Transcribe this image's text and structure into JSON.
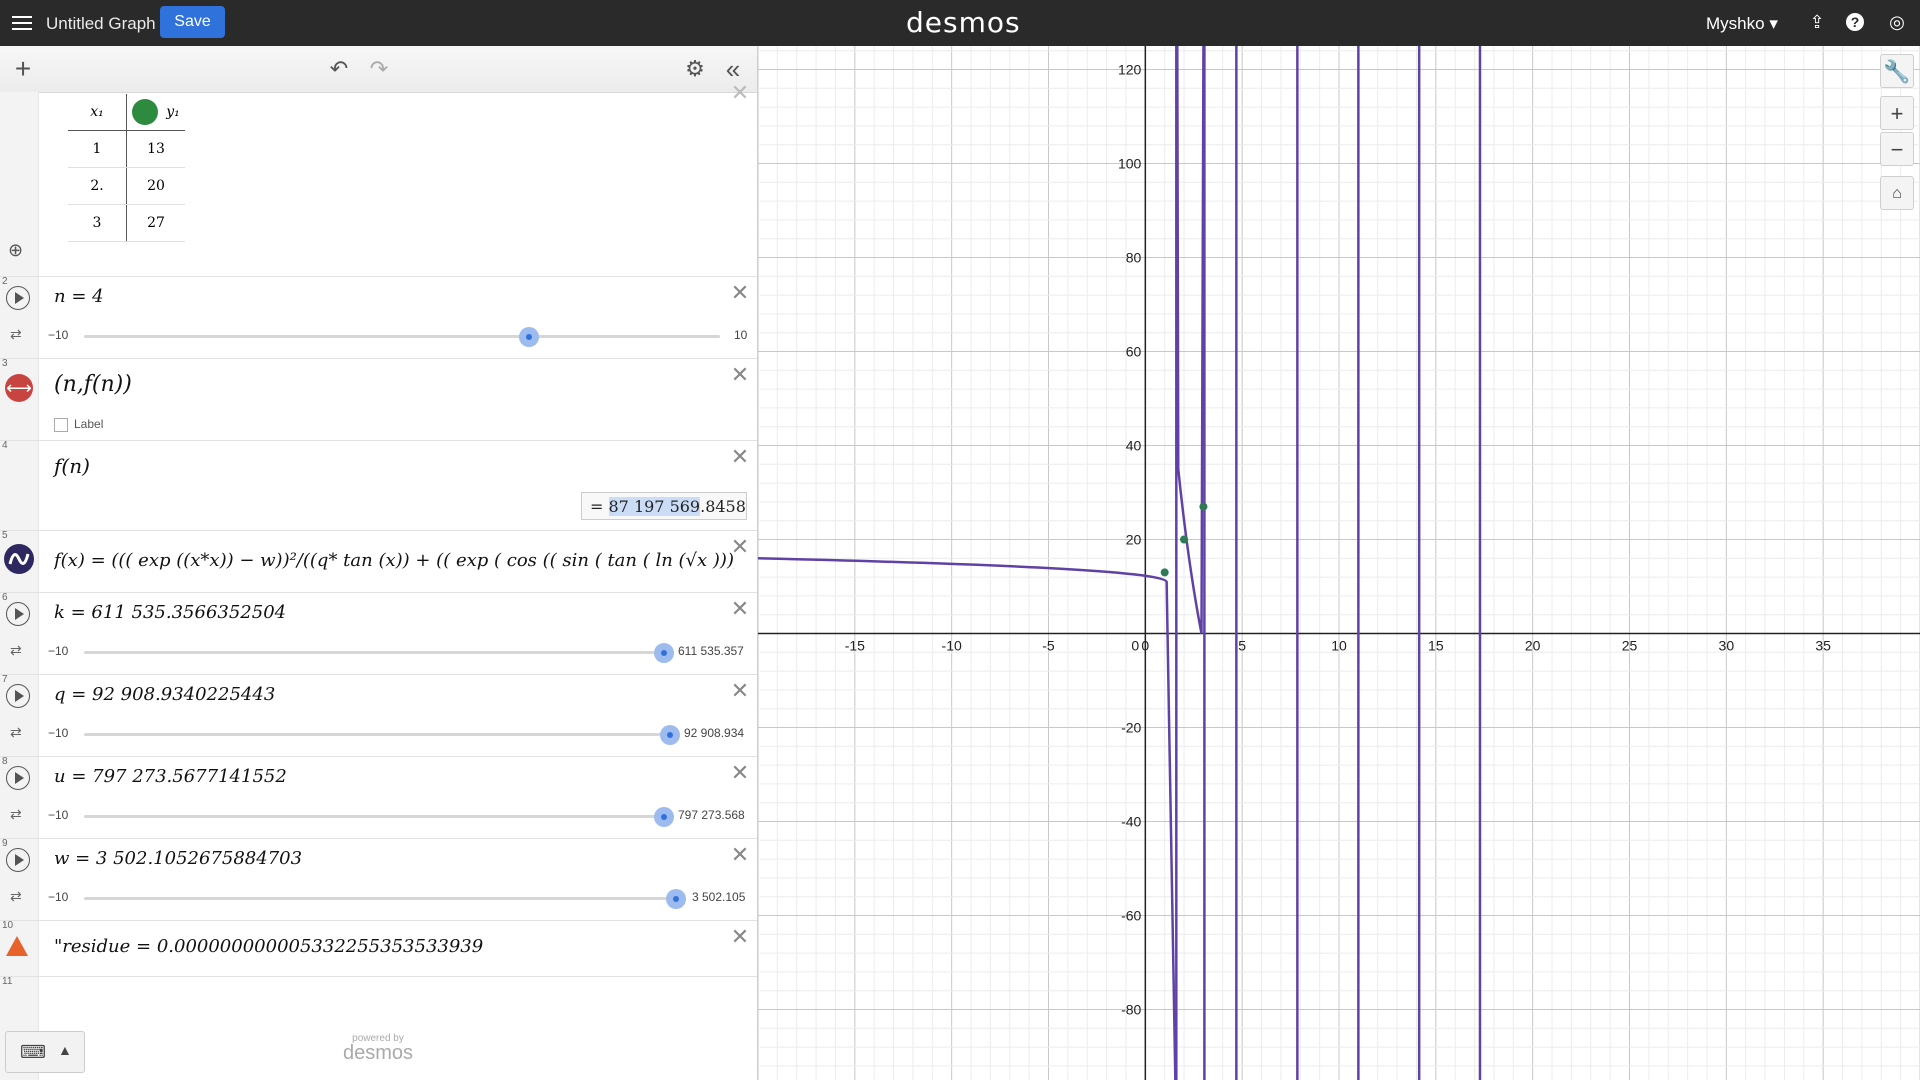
{
  "topbar": {
    "title": "Untitled Graph",
    "save_label": "Save",
    "logo": "desmos",
    "user": "Myshko"
  },
  "table_expr": {
    "headers": [
      "x₁",
      "y₁"
    ],
    "rows": [
      [
        "1",
        "13"
      ],
      [
        "2.",
        "20"
      ],
      [
        "3",
        "27"
      ]
    ]
  },
  "expressions": [
    {
      "num": "2",
      "latex": "n = 4",
      "slider": {
        "min": "−10",
        "max": "10",
        "fraction": 0.7
      }
    },
    {
      "num": "3",
      "latex": "(n,f(n))",
      "label_checkbox": "Label"
    },
    {
      "num": "4",
      "latex": "f(n)",
      "value_prefix": "=",
      "value_hl": "87 197 569",
      "value_rest": ".8458"
    },
    {
      "num": "5",
      "latex": "f(x) = ((( exp ((x*x)) − w))²/((q* tan (x)) + (( exp ( cos (( sin ( tan ( ln (√x ))))*k)))"
    },
    {
      "num": "6",
      "latex": "k = 611 535.3566352504",
      "slider": {
        "min": "−10",
        "max": "611 535.357",
        "fraction": 1.0
      }
    },
    {
      "num": "7",
      "latex": "q = 92 908.9340225443",
      "slider": {
        "min": "−10",
        "max": "92 908.934",
        "fraction": 1.0
      }
    },
    {
      "num": "8",
      "latex": "u = 797 273.5677141552",
      "slider": {
        "min": "−10",
        "max": "797 273.568",
        "fraction": 1.0
      }
    },
    {
      "num": "9",
      "latex": "w = 3 502.1052675884703",
      "slider": {
        "min": "−10",
        "max": "3 502.105",
        "fraction": 1.0
      }
    },
    {
      "num": "10",
      "latex": "\"residue = 0.000000000005332255353533939"
    },
    {
      "num": "11"
    }
  ],
  "footer": {
    "powered_by": "powered by",
    "logo": "desmos"
  },
  "graph": {
    "x_range": [
      -20,
      40
    ],
    "y_range": [
      -95,
      125
    ],
    "x_ticks": [
      -15,
      -10,
      -5,
      0,
      5,
      10,
      15,
      20,
      25,
      30,
      35
    ],
    "y_ticks": [
      120,
      100,
      80,
      60,
      40,
      20,
      -20,
      -40,
      -60,
      -80
    ],
    "asymptotes_x": [
      1.6,
      3.05,
      4.7,
      7.85,
      11.0,
      14.14,
      17.28
    ],
    "points": [
      [
        1,
        13
      ],
      [
        2,
        20
      ],
      [
        3,
        27
      ]
    ],
    "curve_color": "#6042a6",
    "point_color": "#2d7a55"
  }
}
